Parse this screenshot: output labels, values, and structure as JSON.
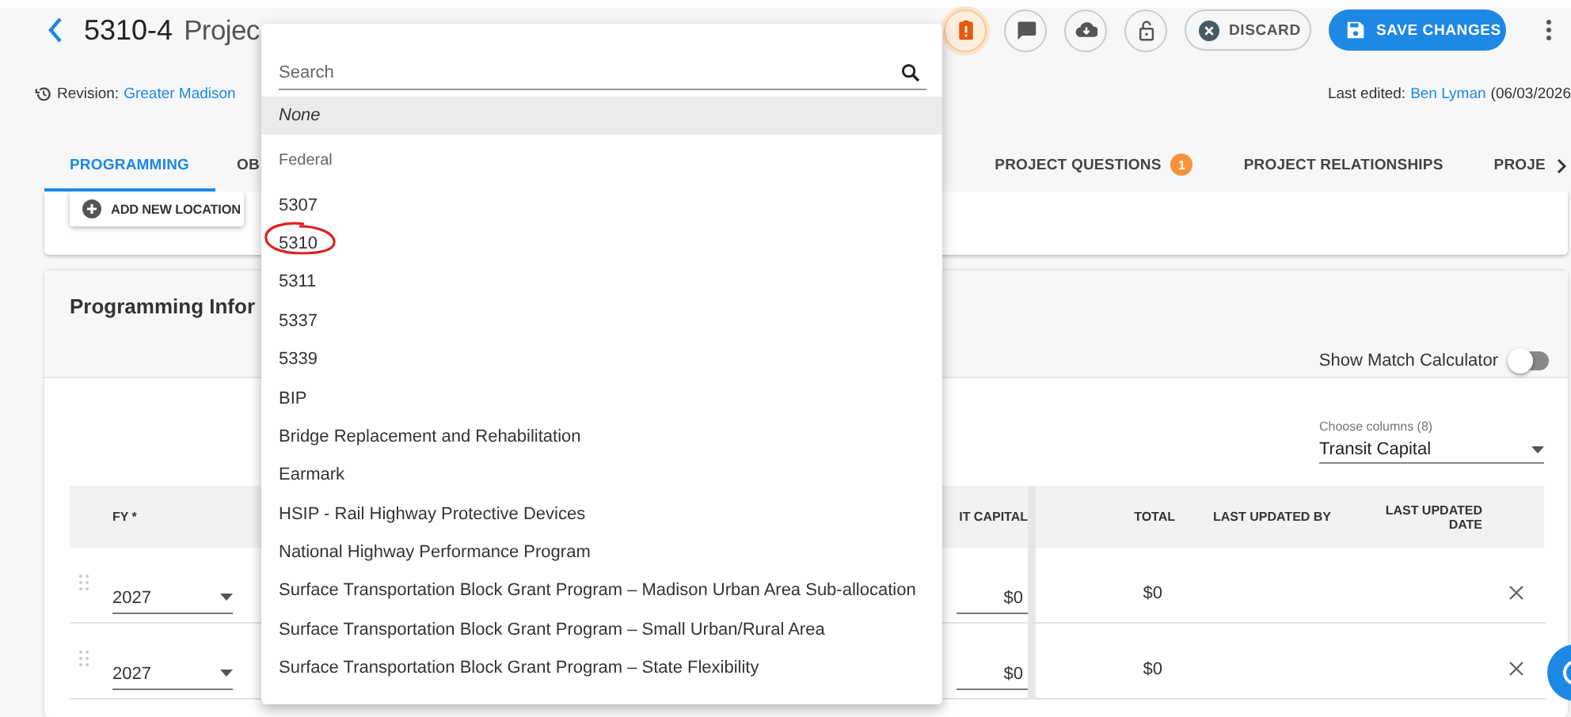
{
  "header": {
    "project_number": "5310-4",
    "project_title": "Projec",
    "revision_label": "Revision:",
    "revision_link": "Greater Madison",
    "last_edited_label": "Last edited:",
    "last_edited_by": "Ben Lyman",
    "last_edited_date": "(06/03/2026",
    "actions": [
      {
        "kind": "alert"
      },
      {
        "kind": "comment"
      },
      {
        "kind": "download"
      },
      {
        "kind": "lock"
      }
    ],
    "discard": "DISCARD",
    "save": "SAVE CHANGES"
  },
  "tabs": [
    {
      "label": "PROGRAMMING",
      "selected": true
    },
    {
      "label": "OB",
      "selected": false
    },
    {
      "label": "PROJECT QUESTIONS",
      "badge": "1",
      "selected": false
    },
    {
      "label": "PROJECT RELATIONSHIPS",
      "selected": false
    },
    {
      "label": "PROJE",
      "selected": false
    }
  ],
  "location_button": "ADD NEW LOCATION",
  "programming": {
    "title": "Programming Infor",
    "match_calculator": {
      "label": "Show Match Calculator",
      "on": false
    },
    "columns_select": {
      "label": "Choose columns (8)",
      "value": "Transit Capital"
    },
    "table": {
      "columns": [
        "FY *",
        "IT CAPITAL",
        "TOTAL",
        "LAST UPDATED BY",
        "LAST UPDATED DATE"
      ],
      "rows": [
        {
          "fy": "2027",
          "capital": "$0",
          "total": "$0"
        },
        {
          "fy": "2027",
          "capital": "$0",
          "total": "$0"
        }
      ]
    }
  },
  "dropdown": {
    "placeholder": "Search",
    "options": [
      {
        "label": "None",
        "kind": "none",
        "selected": true
      },
      {
        "label": "Federal",
        "kind": "group",
        "selected": false
      },
      {
        "label": "5307",
        "kind": "option",
        "selected": false,
        "circled": false
      },
      {
        "label": "5310",
        "kind": "option",
        "selected": false,
        "circled": true
      },
      {
        "label": "5311",
        "kind": "option",
        "selected": false,
        "circled": false
      },
      {
        "label": "5337",
        "kind": "option",
        "selected": false,
        "circled": false
      },
      {
        "label": "5339",
        "kind": "option",
        "selected": false,
        "circled": false
      },
      {
        "label": "BIP",
        "kind": "option",
        "selected": false,
        "circled": false
      },
      {
        "label": "Bridge Replacement and Rehabilitation",
        "kind": "option",
        "selected": false,
        "circled": false
      },
      {
        "label": "Earmark",
        "kind": "option",
        "selected": false,
        "circled": false
      },
      {
        "label": "HSIP - Rail Highway Protective Devices",
        "kind": "option",
        "selected": false,
        "circled": false
      },
      {
        "label": "National Highway Performance Program",
        "kind": "option",
        "selected": false,
        "circled": false
      },
      {
        "label": "Surface Transportation Block Grant Program – Madison Urban Area Sub-allocation",
        "kind": "option",
        "selected": false,
        "circled": false
      },
      {
        "label": "Surface Transportation Block Grant Program – Small Urban/Rural Area",
        "kind": "option",
        "selected": false,
        "circled": false
      },
      {
        "label": "Surface Transportation Block Grant Program – State Flexibility",
        "kind": "option",
        "selected": false,
        "circled": false
      }
    ]
  }
}
